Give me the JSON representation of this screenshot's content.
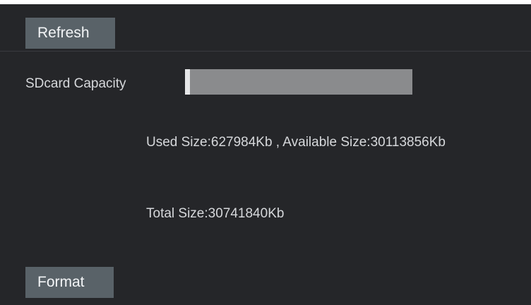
{
  "toolbar": {
    "refresh_label": "Refresh"
  },
  "sdcard": {
    "capacity_label": "SDcard Capacity",
    "used_fraction": 0.0204,
    "usage_text": "Used Size:627984Kb , Available Size:30113856Kb",
    "total_text": "Total Size:30741840Kb"
  },
  "actions": {
    "format_label": "Format"
  },
  "colors": {
    "background": "#252629",
    "button": "#596268",
    "bar_track": "#8a8b8d",
    "bar_fill": "#e6e7e8",
    "text": "#d6d8db"
  }
}
